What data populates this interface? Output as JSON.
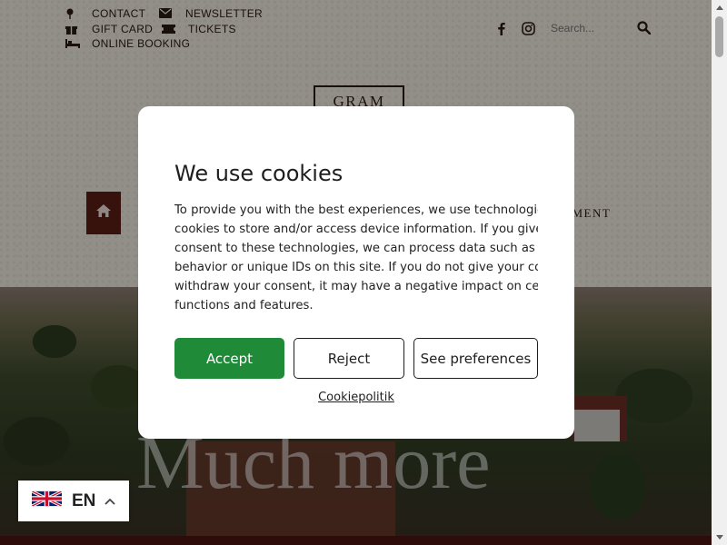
{
  "topnav": {
    "contact": "CONTACT",
    "newsletter": "NEWSLETTER",
    "gift_card": "GIFT CARD",
    "tickets": "TICKETS",
    "online_booking": "ONLINE BOOKING"
  },
  "search": {
    "placeholder": "Search..."
  },
  "social": [
    "facebook-icon",
    "instagram-icon"
  ],
  "logo": {
    "text": "GRAM"
  },
  "menu": {
    "partial_item": "EMENT"
  },
  "hero": {
    "title": "Much more"
  },
  "cookie_dialog": {
    "title": "We use cookies",
    "body_lines": [
      "To provide you with the best experiences, we use technologies such as",
      "cookies to store and/or access device information. If you give your",
      "consent to these technologies, we can process data such as browsing",
      "behavior or unique IDs on this site. If you do not give your consent or",
      "withdraw your consent, it may have a negative impact on certain",
      "functions and features."
    ],
    "accept": "Accept",
    "reject": "Reject",
    "preferences": "See preferences",
    "policy_link": "Cookiepolitik"
  },
  "language": {
    "code": "EN",
    "flag": "uk-flag-icon"
  },
  "colors": {
    "accent_green": "#1f8a37",
    "brand_maroon": "#5a1c14",
    "paper": "#ece6dc"
  }
}
